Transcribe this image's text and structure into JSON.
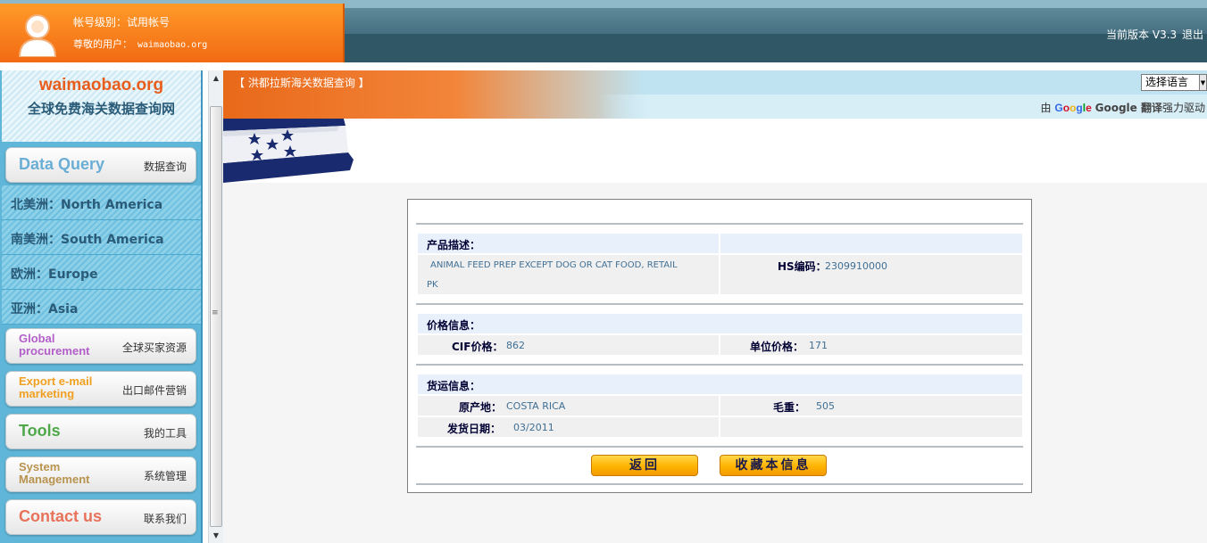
{
  "header": {
    "account_level": "帐号级别：试用帐号",
    "user_label": "尊敬的用户：",
    "username": "waimaobao.org",
    "version": "当前版本 V3.3",
    "logout": "退出"
  },
  "sidebar": {
    "logo_domain": "waimaobao.org",
    "logo_slogan": "全球免费海关数据查询网",
    "data_query": {
      "en": "Data Query",
      "cn": "数据查询",
      "color": "#6aaed6"
    },
    "regions": [
      "北美洲：North America",
      "南美洲：South America",
      "欧洲：Europe",
      "亚洲：Asia"
    ],
    "global_procurement": {
      "en1": "Global",
      "en2": "procurement",
      "cn": "全球买家资源",
      "color": "#b35fc9"
    },
    "export_email": {
      "en1": "Export e-mail",
      "en2": "marketing",
      "cn": "出口邮件营销",
      "color": "#f0a020"
    },
    "tools": {
      "en": "Tools",
      "cn": "我的工具",
      "color": "#4fa84a"
    },
    "system": {
      "en1": "System",
      "en2": "Management",
      "cn": "系统管理",
      "color": "#b8934e"
    },
    "contact": {
      "en": "Contact us",
      "cn": "联系我们",
      "color": "#e8725a"
    }
  },
  "content": {
    "banner_title": "【 洪都拉斯海关数据查询 】",
    "language_select": "选择语言",
    "translate_prefix": "由",
    "google_letters": [
      "G",
      "o",
      "o",
      "g",
      "l",
      "e"
    ],
    "translate_brand": "Google 翻译",
    "translate_suffix": "强力驱动"
  },
  "detail": {
    "product_section": "产品描述：",
    "product_desc": "ANIMAL FEED PREP EXCEPT DOG OR CAT FOOD, RETAIL",
    "product_desc2": "PK",
    "hs_label": "HS编码：",
    "hs_value": "2309910000",
    "price_section": "价格信息：",
    "cif_label": "CIF价格：",
    "cif_value": "862",
    "unit_label": "单位价格：",
    "unit_value": "171",
    "shipping_section": "货运信息：",
    "origin_label": "原产地：",
    "origin_value": "COSTA RICA",
    "weight_label": "毛重：",
    "weight_value": "505",
    "date_label": "发货日期：",
    "date_value": "03/2011",
    "back_button": "返回",
    "save_button": "收藏本信息"
  }
}
